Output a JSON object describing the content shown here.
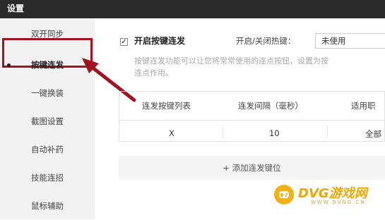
{
  "window": {
    "title": "设置"
  },
  "sidebar": {
    "items": [
      {
        "label": "双开同步"
      },
      {
        "label": "按键连发"
      },
      {
        "label": "一键换装"
      },
      {
        "label": "截图设置"
      },
      {
        "label": "自动补药"
      },
      {
        "label": "技能连招"
      },
      {
        "label": "鼠标辅助"
      }
    ],
    "active_index": 1,
    "highlight_color": "#a01320"
  },
  "main": {
    "enable_label": "开启按键连发",
    "enable_checked": true,
    "hotkey_label": "开启/关闭热键：",
    "hotkey_value": "未使用",
    "description_line1": "按键连发功能可以让您将常常使用的连点按钮，设置为按",
    "description_line2": "连点作用。",
    "table": {
      "headers": [
        "连发按键列表",
        "连发间隔（毫秒）",
        "适用职"
      ],
      "rows": [
        [
          "X",
          "10",
          "全部"
        ]
      ]
    },
    "add_button_label": "+ 添加连发键位"
  },
  "watermark": {
    "text": "DVG游戏网",
    "url": "WWW.DVGG.CN",
    "color": "#f0a800"
  }
}
